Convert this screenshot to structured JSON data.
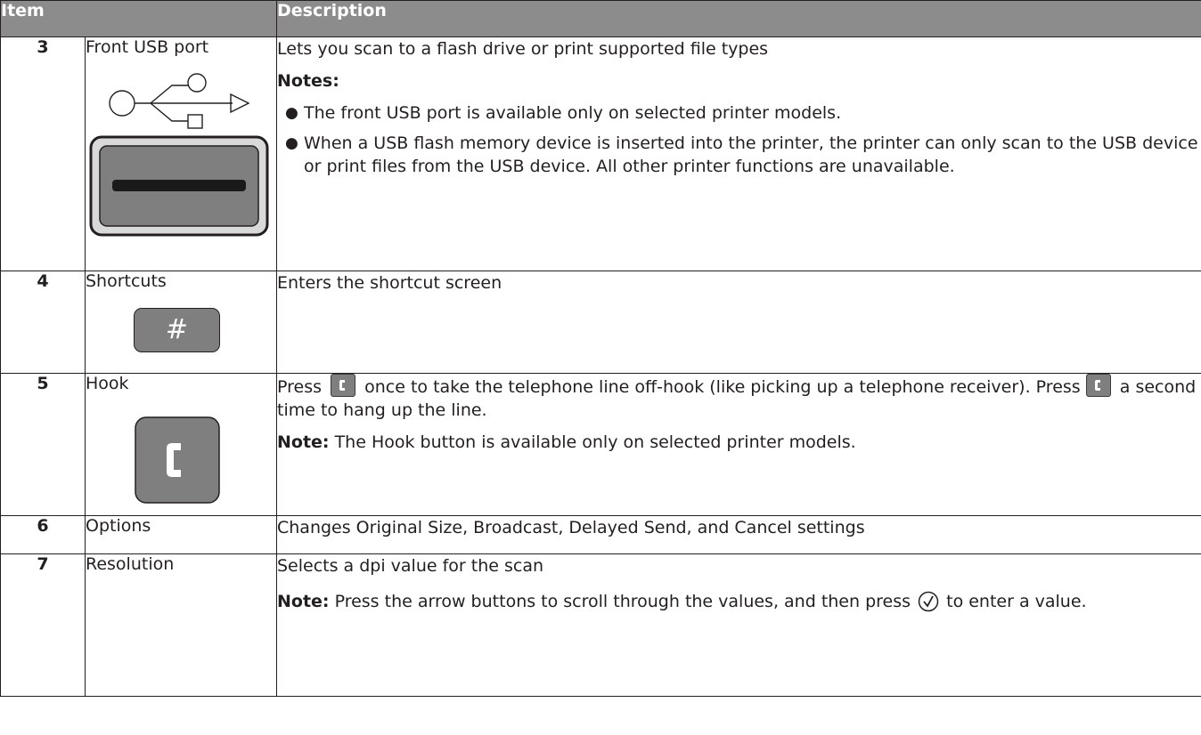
{
  "header": {
    "col_item": "Item",
    "col_description": "Description"
  },
  "rows": [
    {
      "num": "3",
      "name": "Front USB port",
      "icon": "usb-port-icon",
      "text": "Lets you scan to a flash drive or print supported file types",
      "notes_label": "Notes:",
      "bullets": [
        "The front USB port is available only on selected printer models.",
        "When a USB flash memory device is inserted into the printer, the printer can only scan to the USB device or print files from the USB device. All other printer functions are unavailable."
      ]
    },
    {
      "num": "4",
      "name": "Shortcuts",
      "icon": "shortcuts-key-icon",
      "key_label": "#",
      "text": "Enters the shortcut screen"
    },
    {
      "num": "5",
      "name": "Hook",
      "icon": "hook-phone-icon",
      "text_a": "Press",
      "text_b": "once to take the telephone line off-hook (like picking up a telephone receiver). Press",
      "text_c": "a second time to hang up the line.",
      "note_label": "Note:",
      "note_text": "The Hook button is available only on selected printer models."
    },
    {
      "num": "6",
      "name": "Options",
      "text": "Changes Original Size, Broadcast, Delayed Send, and Cancel settings"
    },
    {
      "num": "7",
      "name": "Resolution",
      "icon": "checkmark-circle-icon",
      "text": "Selects a dpi value for the scan",
      "note_label": "Note:",
      "note_text_a": "Press the arrow buttons to scroll through the values, and then press",
      "note_text_b": "to enter a value."
    }
  ]
}
